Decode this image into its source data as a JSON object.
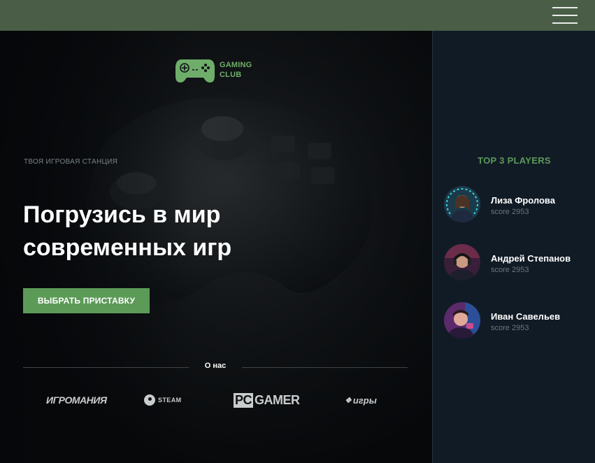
{
  "header": {
    "menu_icon": "hamburger-menu-icon"
  },
  "logo": {
    "line1": "GAMING",
    "line2": "CLUB",
    "icon": "gamepad-icon",
    "color": "#6fae6a"
  },
  "hero": {
    "tagline": "ТВОЯ ИГРОВАЯ СТАНЦИЯ",
    "headline_line1": "Погрузись в мир",
    "headline_line2": "современных игр",
    "cta_label": "ВЫБРАТЬ ПРИСТАВКУ",
    "about_label": "О нас",
    "partners": [
      {
        "name": "ИГРОМАНИЯ"
      },
      {
        "name": "STEAM"
      },
      {
        "name": "GAMER",
        "prefix": "PC"
      },
      {
        "name": "игры"
      }
    ]
  },
  "sidebar": {
    "title": "TOP 3 PLAYERS",
    "players": [
      {
        "name": "Лиза Фролова",
        "score_label": "score",
        "score": "2953"
      },
      {
        "name": "Андрей Степанов",
        "score_label": "score",
        "score": "2953"
      },
      {
        "name": "Иван Савельев",
        "score_label": "score",
        "score": "2953"
      }
    ]
  },
  "colors": {
    "topbar": "#4a5e47",
    "accent": "#5c9a58",
    "sidebar_bg": "#111b26",
    "hero_bg": "#0b0f14"
  }
}
